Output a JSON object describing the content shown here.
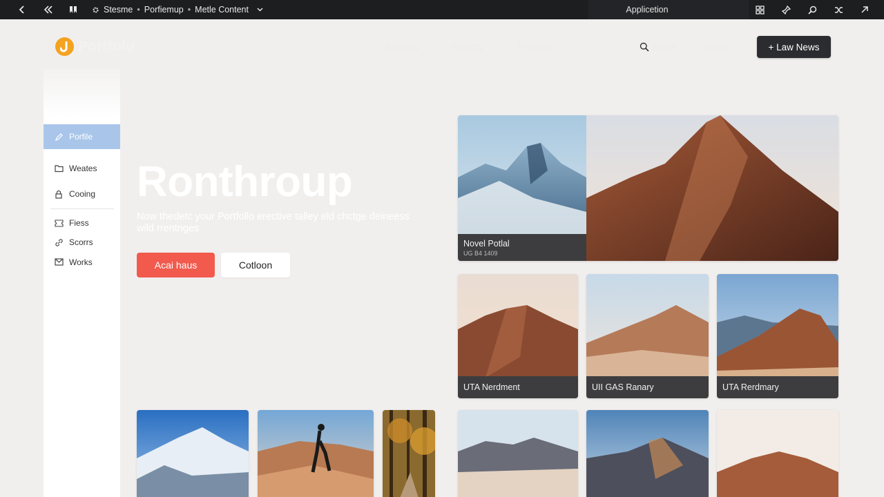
{
  "topbar": {
    "breadcrumb": [
      "Stesme",
      "Porfiemup",
      "Metle Content"
    ],
    "app_title": "Applicetion",
    "icons_left": [
      "back-icon",
      "double-back-icon",
      "bookmark-icon",
      "gear-icon"
    ],
    "icons_right": [
      "grid-icon",
      "pin-icon",
      "search-icon",
      "shuffle-icon",
      "arrow-out-icon"
    ]
  },
  "header": {
    "logo_text": "Portfolu",
    "nav": [
      "Senurts",
      "Regicty",
      "Fnctings"
    ],
    "search_label": "Baign",
    "reads_label": "Reaps",
    "new_button": "+ Law News"
  },
  "sidebar": {
    "items": [
      {
        "label": "Porfile",
        "icon": "pencil-icon",
        "active": true
      },
      {
        "label": "Weates",
        "icon": "folder-icon",
        "active": false
      },
      {
        "label": "Cooing",
        "icon": "lock-icon",
        "active": false
      },
      {
        "label": "Fiess",
        "icon": "ticket-icon",
        "active": false
      },
      {
        "label": "Scorrs",
        "icon": "link-icon",
        "active": false
      },
      {
        "label": "Works",
        "icon": "mail-icon",
        "active": false
      }
    ]
  },
  "hero": {
    "title": "Ronthroup",
    "subtitle": "Now thedetc your Portfollo erective talley eld chctge deineess wild rrentnges",
    "primary_button": "Acai haus",
    "secondary_button": "Cotloon"
  },
  "featured": {
    "caption": "Novel Potlal",
    "meta": "UG B4 1409"
  },
  "cards": [
    {
      "caption": "UTA Nerdment"
    },
    {
      "caption": "UII GAS Ranary"
    },
    {
      "caption": "UTA Rerdmary"
    }
  ],
  "colors": {
    "accent_red": "#f25a4d",
    "sidebar_active": "#a9c6ea",
    "logo_orange": "#f4a321",
    "dark_button": "#2b2c2f"
  }
}
